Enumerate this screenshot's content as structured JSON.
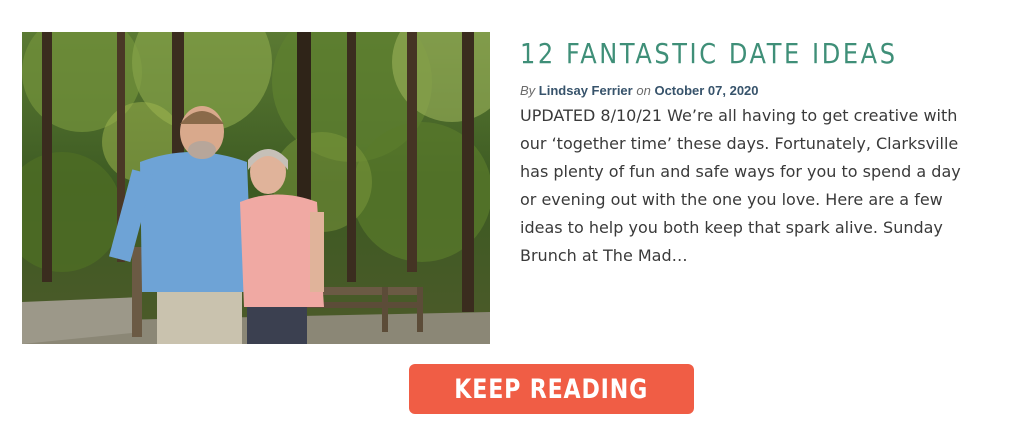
{
  "post": {
    "title": "12 FANTASTIC DATE IDEAS",
    "by_label": "By",
    "author": "Lindsay Ferrier",
    "on_label": "on",
    "date": "October 07, 2020",
    "excerpt": "UPDATED 8/10/21 We’re all having to get creative with our ‘together time’ these days. Fortunately, Clarksville has plenty of fun and safe ways for you to spend a day or evening out with the one you love. Here are a few ideas to help you both keep that spark alive. Sunday Brunch at The Mad…",
    "button_label": "KEEP READING"
  },
  "colors": {
    "title": "#3f8f78",
    "author_link": "#37536b",
    "button_bg": "#f05d45"
  }
}
